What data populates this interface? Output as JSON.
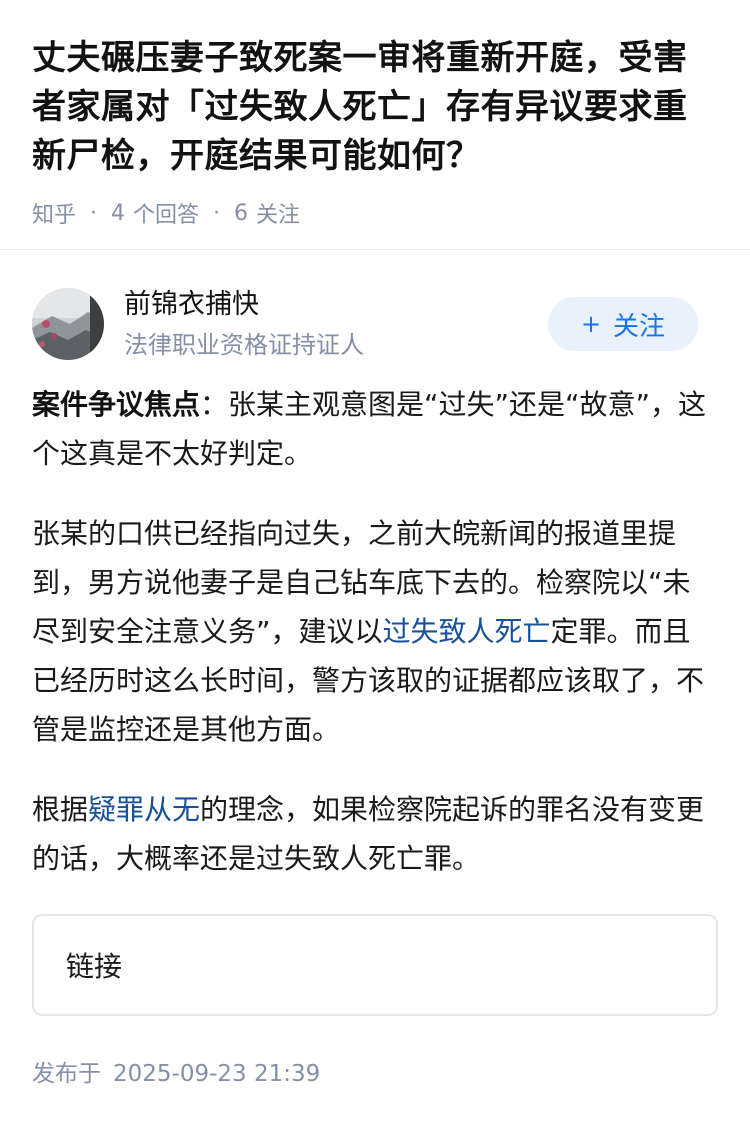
{
  "question": {
    "title": "丈夫碾压妻子致死案一审将重新开庭，受害者家属对「过失致人死亡」存有异议要求重新尸检，开庭结果可能如何？",
    "source": "知乎",
    "answers_count": "4",
    "answers_label": "个回答",
    "followers_count": "6",
    "followers_label": "关注"
  },
  "author": {
    "name": "前锦衣捕快",
    "description": "法律职业资格证持证人",
    "follow_label": "关注",
    "follow_plus": "+"
  },
  "answer": {
    "p1_bold": "案件争议焦点",
    "p1_text": "：张某主观意图是“过失”还是“故意”，这个这真是不太好判定。",
    "p2_part1": "张某的口供已经指向过失，之前大皖新闻的报道里提到，男方说他妻子是自己钻车底下去的。检察院以“未尽到安全注意义务”，建议以",
    "p2_link": "过失致人死亡",
    "p2_part2": "定罪。而且已经历时这么长时间，警方该取的证据都应该取了，不管是监控还是其他方面。",
    "p3_part1": "根据",
    "p3_link": "疑罪从无",
    "p3_part2": "的理念，如果检察院起诉的罪名没有变更的话，大概率还是过失致人死亡罪。"
  },
  "link_card": {
    "label": "链接"
  },
  "footer": {
    "published_label": "发布于",
    "timestamp": "2025-09-23 21:39"
  },
  "colors": {
    "accent": "#1772f6",
    "link": "#175199",
    "meta": "#8590a6",
    "follow_bg": "#e9f1fc"
  },
  "icons": {
    "avatar": "avatar-image"
  }
}
